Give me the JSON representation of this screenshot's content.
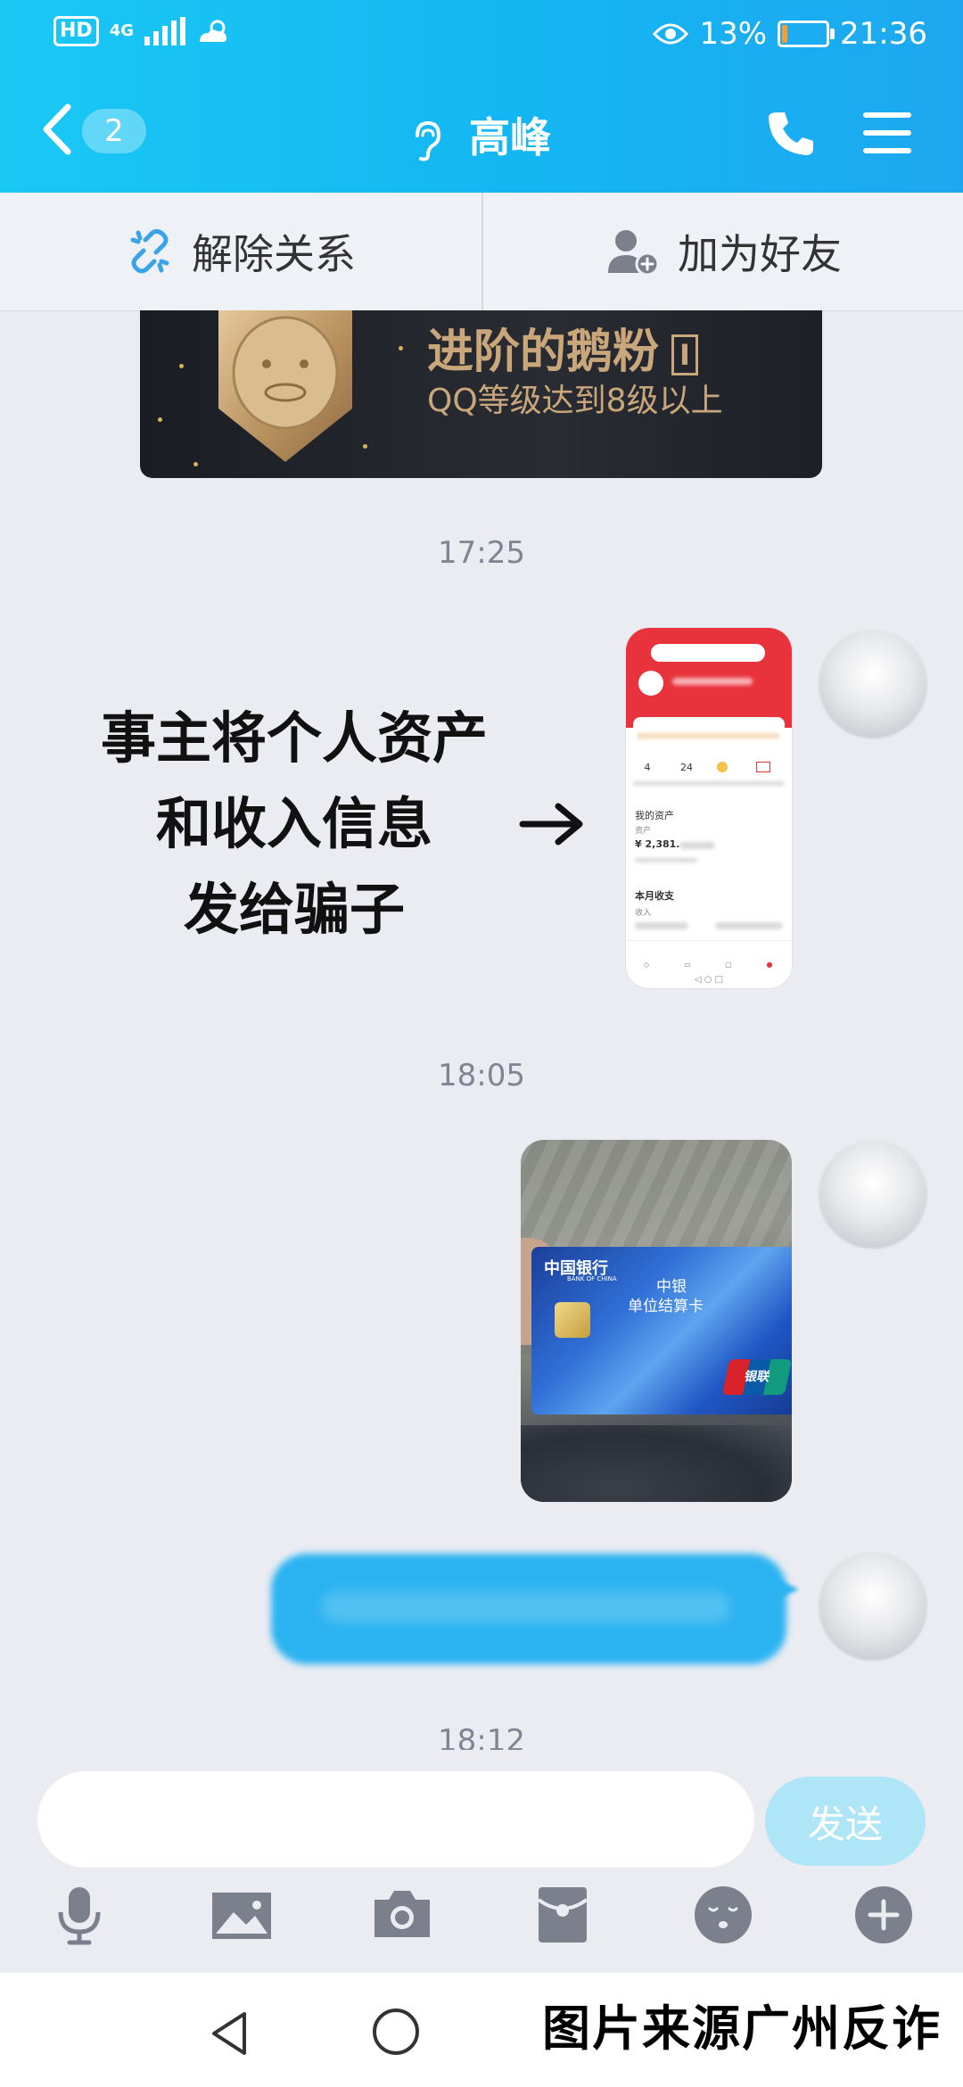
{
  "status_bar": {
    "hd": "HD",
    "network": "4G",
    "battery_percent": "13%",
    "battery_level": 0.13,
    "time": "21:36"
  },
  "header": {
    "unread_count": "2",
    "contact_name": "高峰"
  },
  "relation_bar": {
    "remove_label": "解除关系",
    "add_friend_label": "加为好友"
  },
  "banner": {
    "title": "进阶的鹅粉",
    "level_mark": "I",
    "subtitle": "QQ等级达到8级以上"
  },
  "messages": {
    "time_1": "17:25",
    "time_2": "18:05",
    "time_3": "18:12"
  },
  "annotation": {
    "line1": "事主将个人资产",
    "line2": "和收入信息",
    "line3": "发给骗子"
  },
  "screenshot_thumb": {
    "stat1_num": "4",
    "stat2_num": "24",
    "assets_label": "我的资产",
    "assets_sub": "资产",
    "assets_value": "¥ 2,381.",
    "income_label": "本月收支",
    "income_sub": "收入"
  },
  "bank_card": {
    "bank_name": "中国银行",
    "bank_en": "BANK OF CHINA",
    "card_title": "中银",
    "card_subtitle": "单位结算卡",
    "unionpay": "银联"
  },
  "input": {
    "placeholder": "",
    "send_label": "发送"
  },
  "watermark": "图片来源广州反诈",
  "colors": {
    "header_gradient_start": "#1ac8f4",
    "header_gradient_end": "#1ea7f0",
    "bubble": "#2bb3f1",
    "send_button": "#aee6f8",
    "background": "#eaecf2"
  }
}
